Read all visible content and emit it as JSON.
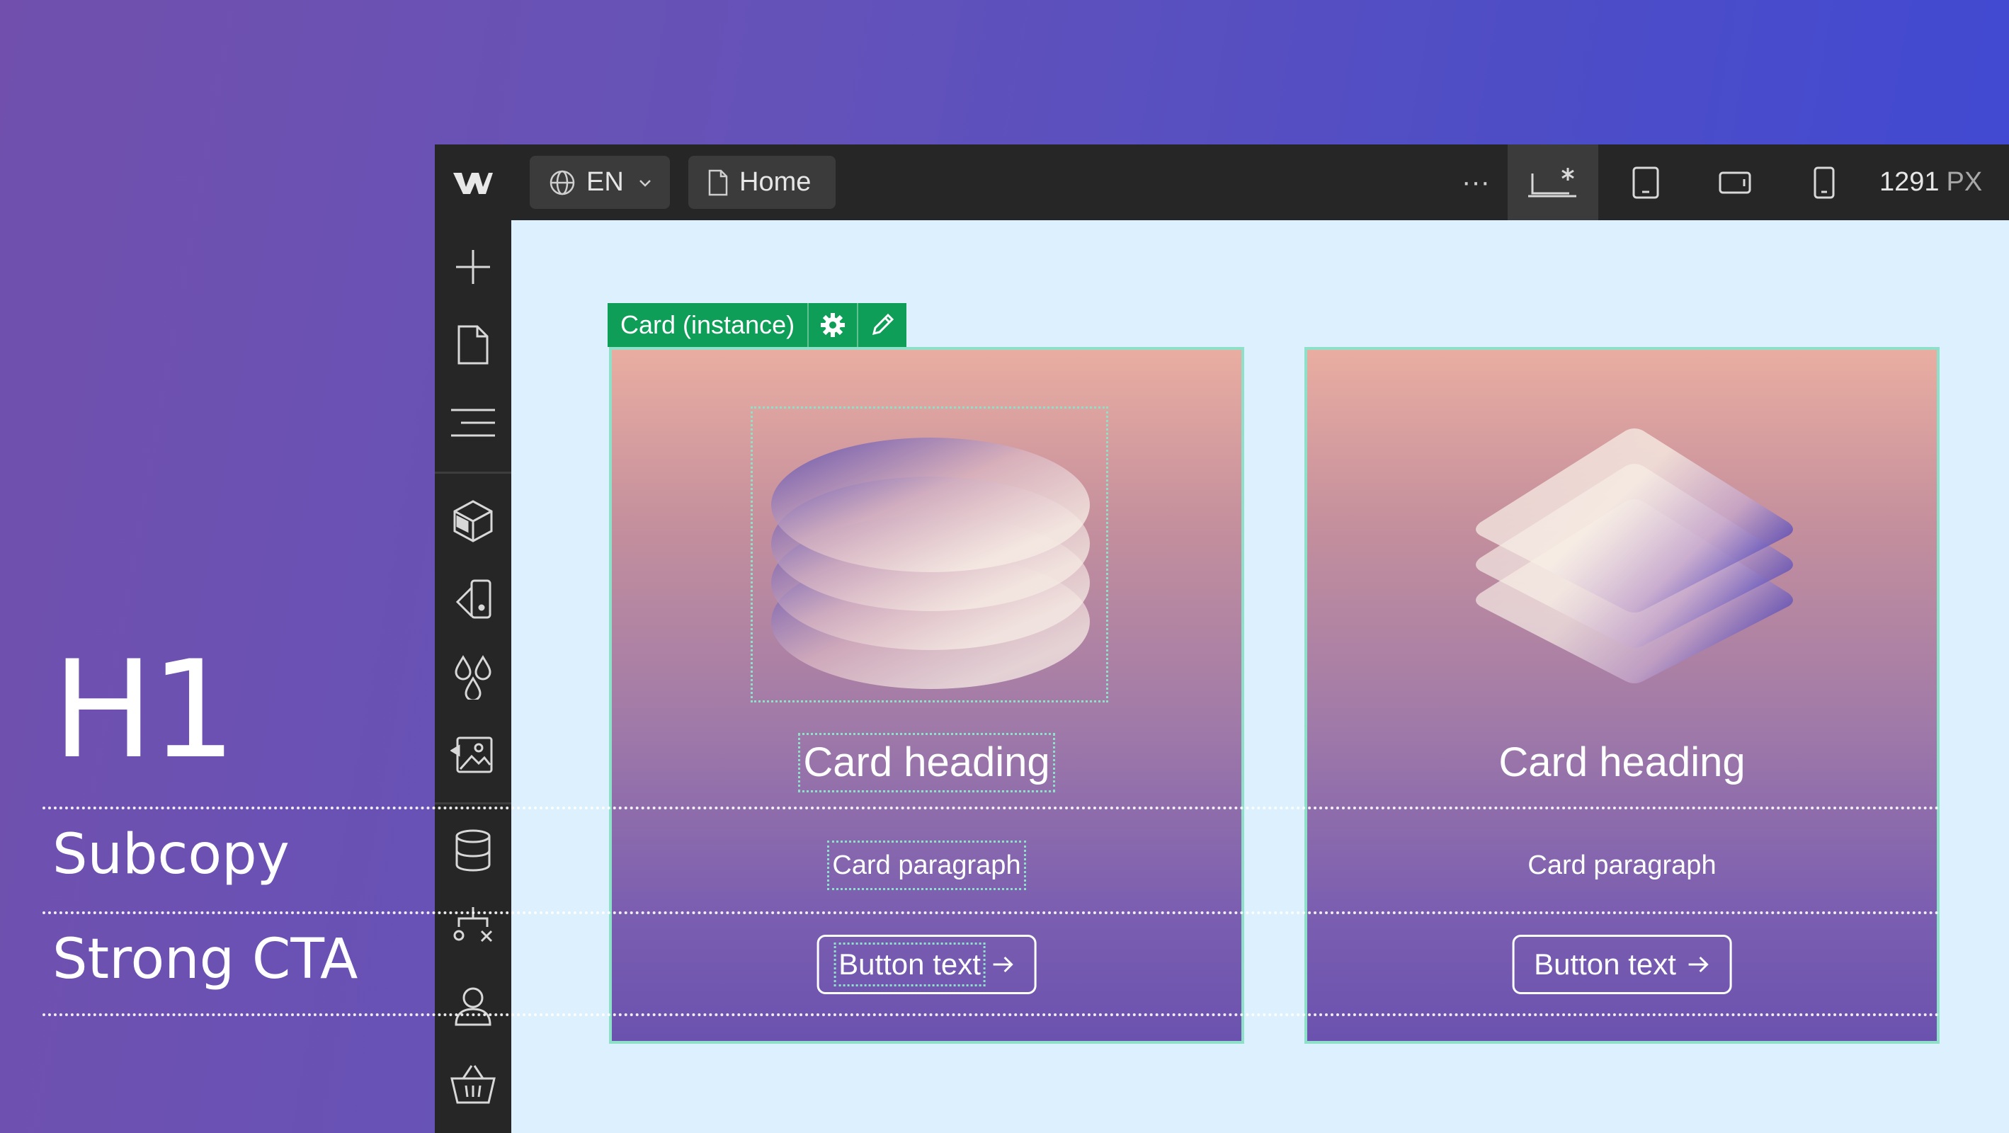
{
  "typography": {
    "h1": "H1",
    "subcopy": "Subcopy",
    "strong_cta": "Strong CTA"
  },
  "topbar": {
    "language": "EN",
    "page": "Home",
    "more": "···",
    "width_value": "1291",
    "width_unit": "PX"
  },
  "sidebar": {
    "items": [
      "add-icon",
      "pages-icon",
      "navigator-icon",
      "components-icon",
      "style-selector-icon",
      "variables-icon",
      "assets-icon",
      "cms-icon",
      "logic-icon",
      "users-icon",
      "ecommerce-icon"
    ]
  },
  "selection": {
    "label": "Card (instance)"
  },
  "cards": [
    {
      "heading": "Card heading",
      "paragraph": "Card paragraph",
      "button": "Button text"
    },
    {
      "heading": "Card heading",
      "paragraph": "Card paragraph",
      "button": "Button text"
    }
  ],
  "colors": {
    "accent_green": "#0e9e58",
    "selection_outline": "#8ee0c8",
    "canvas_bg": "#ddf0fd",
    "chrome_bg": "#262626"
  }
}
